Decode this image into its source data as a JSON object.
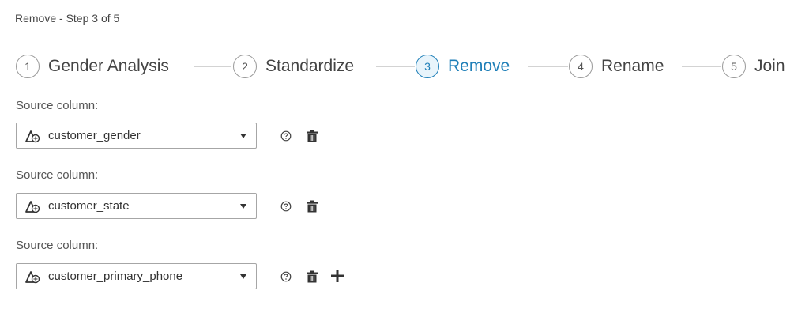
{
  "header": {
    "title": "Remove - Step 3 of 5"
  },
  "stepper": {
    "steps": [
      {
        "number": "1",
        "label": "Gender Analysis",
        "active": false
      },
      {
        "number": "2",
        "label": "Standardize",
        "active": false
      },
      {
        "number": "3",
        "label": "Remove",
        "active": true
      },
      {
        "number": "4",
        "label": "Rename",
        "active": false
      },
      {
        "number": "5",
        "label": "Join",
        "active": false
      }
    ]
  },
  "columns": [
    {
      "label": "Source column:",
      "value": "customer_gender",
      "icon": "character-column-icon"
    },
    {
      "label": "Source column:",
      "value": "customer_state",
      "icon": "character-column-icon"
    },
    {
      "label": "Source column:",
      "value": "customer_primary_phone",
      "icon": "character-column-icon"
    }
  ],
  "actions": {
    "help_icon": "help-icon",
    "delete_icon": "trash-icon",
    "add_icon": "plus-icon"
  },
  "colors": {
    "accent": "#1f7fb8",
    "active_fill": "#e8f4fb",
    "border": "#a6a6a6"
  }
}
